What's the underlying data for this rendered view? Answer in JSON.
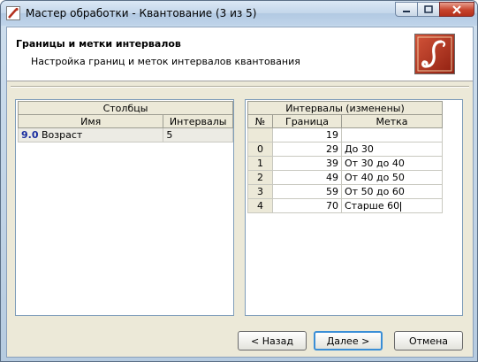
{
  "window": {
    "title": "Мастер обработки - Квантование (3 из 5)"
  },
  "header": {
    "title": "Границы и метки интервалов",
    "subtitle": "Настройка границ и меток интервалов квантования"
  },
  "columns_table": {
    "group_header": "Столбцы",
    "headers": [
      "Имя",
      "Интервалы"
    ],
    "rows": [
      {
        "index": "9.0",
        "name": "Возраст",
        "intervals": "5"
      }
    ]
  },
  "intervals_table": {
    "group_header": "Интервалы (изменены)",
    "headers": [
      "№",
      "Граница",
      "Метка"
    ],
    "rows": [
      {
        "num": "",
        "bound": "19",
        "label": ""
      },
      {
        "num": "0",
        "bound": "29",
        "label": "До 30"
      },
      {
        "num": "1",
        "bound": "39",
        "label": "От 30 до 40"
      },
      {
        "num": "2",
        "bound": "49",
        "label": "От 40 до 50"
      },
      {
        "num": "3",
        "bound": "59",
        "label": "От 50 до 60"
      },
      {
        "num": "4",
        "bound": "70",
        "label": "Старше 60"
      }
    ]
  },
  "buttons": {
    "back": "< Назад",
    "next": "Далее >",
    "cancel": "Отмена"
  },
  "colors": {
    "accent": "#3a8ed6",
    "index_text": "#1a2ea0",
    "logo_bg": "#b5311e"
  },
  "icons": [
    "app-icon",
    "minimize-icon",
    "maximize-icon",
    "close-icon",
    "wizard-logo-icon"
  ]
}
